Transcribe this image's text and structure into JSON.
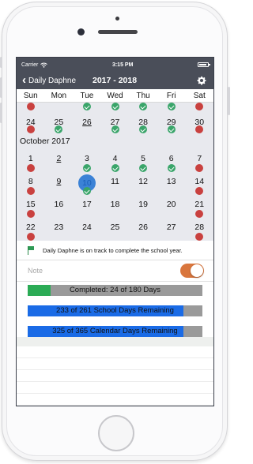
{
  "status": {
    "carrier": "Carrier",
    "time": "3:15 PM"
  },
  "nav": {
    "back_label": "Daily Daphne",
    "title": "2017 - 2018"
  },
  "days": [
    "Sun",
    "Mon",
    "Tue",
    "Wed",
    "Thu",
    "Fri",
    "Sat"
  ],
  "calendar": {
    "top_row": [
      {
        "num": "",
        "dot": "red"
      },
      {
        "num": "",
        "dot": ""
      },
      {
        "num": "",
        "dot": "green"
      },
      {
        "num": "",
        "dot": "green"
      },
      {
        "num": "",
        "dot": "green"
      },
      {
        "num": "",
        "dot": "green"
      },
      {
        "num": "",
        "dot": "red"
      }
    ],
    "sept_last": [
      {
        "num": "24",
        "dot": "red"
      },
      {
        "num": "25",
        "dot": "green"
      },
      {
        "num": "26",
        "dot": "",
        "u": true
      },
      {
        "num": "27",
        "dot": "green"
      },
      {
        "num": "28",
        "dot": "green"
      },
      {
        "num": "29",
        "dot": "green"
      },
      {
        "num": "30",
        "dot": "red"
      }
    ],
    "month_label": "October 2017",
    "oct_weeks": [
      [
        {
          "num": "1",
          "dot": "red"
        },
        {
          "num": "2",
          "dot": "",
          "u": true
        },
        {
          "num": "3",
          "dot": "green"
        },
        {
          "num": "4",
          "dot": "green"
        },
        {
          "num": "5",
          "dot": "green"
        },
        {
          "num": "6",
          "dot": "green"
        },
        {
          "num": "7",
          "dot": "red"
        }
      ],
      [
        {
          "num": "8",
          "dot": "red"
        },
        {
          "num": "9",
          "dot": "",
          "u": true
        },
        {
          "num": "10",
          "dot": "green",
          "today": true
        },
        {
          "num": "11",
          "dot": ""
        },
        {
          "num": "12",
          "dot": ""
        },
        {
          "num": "13",
          "dot": ""
        },
        {
          "num": "14",
          "dot": "red"
        }
      ],
      [
        {
          "num": "15",
          "dot": "red"
        },
        {
          "num": "16",
          "dot": ""
        },
        {
          "num": "17",
          "dot": ""
        },
        {
          "num": "18",
          "dot": ""
        },
        {
          "num": "19",
          "dot": ""
        },
        {
          "num": "20",
          "dot": ""
        },
        {
          "num": "21",
          "dot": "red"
        }
      ],
      [
        {
          "num": "22",
          "dot": "red"
        },
        {
          "num": "23",
          "dot": ""
        },
        {
          "num": "24",
          "dot": ""
        },
        {
          "num": "25",
          "dot": ""
        },
        {
          "num": "26",
          "dot": ""
        },
        {
          "num": "27",
          "dot": ""
        },
        {
          "num": "28",
          "dot": "red"
        }
      ]
    ]
  },
  "message": "Daily Daphne is on track to complete the school year.",
  "note": {
    "label": "Note",
    "toggle_on": true
  },
  "progress": [
    {
      "label": "Completed: 24 of 180 Days",
      "fraction": 0.133,
      "color": "#2bab55"
    },
    {
      "label": "233 of 261 School Days Remaining",
      "fraction": 0.893,
      "color": "#1a6be6"
    },
    {
      "label": "325 of 365 Calendar Days Remaining",
      "fraction": 0.89,
      "color": "#1a6be6"
    }
  ],
  "colors": {
    "nav_bg": "#4a4e59",
    "today": "#3b82d6",
    "red_dot": "#c9413f",
    "green_dot": "#3aa56a",
    "toggle": "#d9763d"
  }
}
